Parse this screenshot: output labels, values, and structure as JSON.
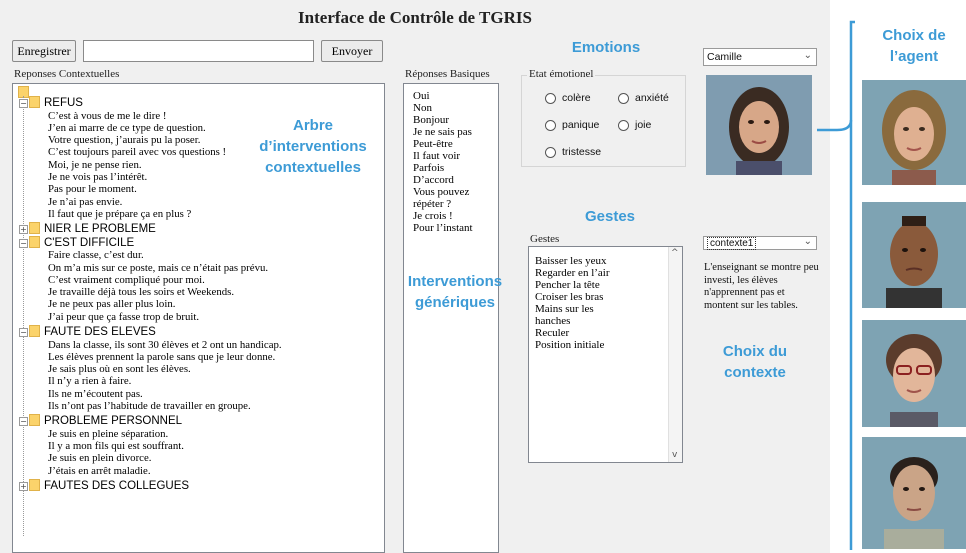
{
  "window": {
    "title": "Interface de Contrôle de TGRIS"
  },
  "toolbar": {
    "save_label": "Enregistrer",
    "send_label": "Envoyer",
    "input_value": ""
  },
  "contextual": {
    "label": "Reponses Contextuelles",
    "nodes": [
      {
        "title": "REFUS",
        "expanded": true,
        "lines": [
          "C’est à vous de me le dire !",
          "J’en ai marre de ce type de question.",
          "Votre question, j’aurais pu la poser.",
          "C’est toujours pareil avec vos questions !",
          "Moi, je ne pense rien.",
          "Je ne vois pas l’intérêt.",
          "Pas pour le moment.",
          "Je n’ai pas envie.",
          "Il faut que je prépare ça en plus ?"
        ]
      },
      {
        "title": "NIER LE PROBLEME",
        "expanded": false,
        "lines": []
      },
      {
        "title": "C'EST DIFFICILE",
        "expanded": true,
        "lines": [
          "Faire classe, c’est dur.",
          "On m’a mis sur ce poste, mais ce n’était pas prévu.",
          "C’est vraiment compliqué pour moi.",
          "Je travaille déjà tous les soirs et Weekends.",
          "Je ne peux pas aller plus loin.",
          "J’ai peur que ça fasse trop de bruit."
        ]
      },
      {
        "title": "FAUTE DES ELEVES",
        "expanded": true,
        "lines": [
          "Dans la classe, ils sont 30 élèves et 2 ont un handicap.",
          "Les élèves prennent la parole sans que je leur donne.",
          "Je sais plus où en sont les élèves.",
          "Il n’y a rien à faire.",
          "Ils ne m’écoutent pas.",
          "Ils n’ont pas l’habitude de travailler en groupe."
        ]
      },
      {
        "title": "PROBLEME PERSONNEL",
        "expanded": true,
        "lines": [
          "Je suis en pleine séparation.",
          "Il y a mon fils qui est souffrant.",
          "Je suis en plein divorce.",
          "J’étais en arrêt maladie."
        ]
      },
      {
        "title": "FAUTES DES COLLEGUES",
        "expanded": false,
        "lines": []
      }
    ]
  },
  "basic": {
    "label": "Réponses Basiques",
    "items": [
      "Oui",
      "Non",
      "Bonjour",
      "Je ne sais pas",
      "Peut-être",
      "Il faut voir",
      "Parfois",
      "D’accord",
      "Vous pouvez",
      "répéter ?",
      "Je crois !",
      "Pour l’instant"
    ]
  },
  "emotions": {
    "legend": "Etat émotionel",
    "options": [
      "colère",
      "anxiété",
      "panique",
      "joie",
      "tristesse"
    ]
  },
  "gestures": {
    "label": "Gestes",
    "items": [
      "Baisser les yeux",
      "Regarder en l’air",
      "Pencher la tête",
      "Croiser les bras",
      "Mains sur les",
      "hanches",
      "Reculer",
      "Position initiale"
    ]
  },
  "agent_select": {
    "value": "Camille"
  },
  "context_select": {
    "value": "contexte1"
  },
  "context_description": "L'enseignant se montre peu investi, les élèves n'apprennent pas et montent sur les tables.",
  "annotations": {
    "emotions": "Emotions",
    "tree": "Arbre d’interventions contextuelles",
    "generic": "Interventions génériques",
    "gestures": "Gestes",
    "context": "Choix du contexte",
    "agent": "Choix de l’agent"
  },
  "colors": {
    "annotation": "#3d9bd6",
    "folder": "#fbd36b",
    "window_bg": "#f0f0f0"
  }
}
